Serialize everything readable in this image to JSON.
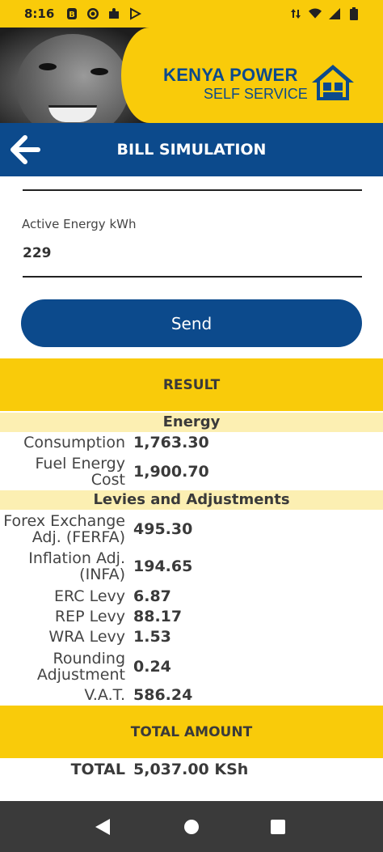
{
  "status_bar": {
    "time": "8:16"
  },
  "header": {
    "brand_title": "KENYA POWER",
    "brand_subtitle": "SELF SERVICE"
  },
  "titlebar": {
    "title": "BILL SIMULATION"
  },
  "form": {
    "field_label": "Active Energy kWh",
    "field_value": "229",
    "send_label": "Send"
  },
  "result": {
    "heading": "RESULT",
    "energy_section": "Energy",
    "energy_rows": [
      {
        "label": "Consumption",
        "value": "1,763.30"
      },
      {
        "label": "Fuel Energy Cost",
        "value": "1,900.70"
      }
    ],
    "levies_section": "Levies and Adjustments",
    "levy_rows": [
      {
        "label": "Forex Exchange Adj. (FERFA)",
        "value": "495.30"
      },
      {
        "label": "Inflation Adj. (INFA)",
        "value": "194.65"
      },
      {
        "label": "ERC Levy",
        "value": "6.87"
      },
      {
        "label": "REP Levy",
        "value": "88.17"
      },
      {
        "label": "WRA Levy",
        "value": "1.53"
      },
      {
        "label": "Rounding Adjustment",
        "value": "0.24"
      },
      {
        "label": "V.A.T.",
        "value": "586.24"
      }
    ],
    "total_heading": "TOTAL AMOUNT",
    "total_label": "TOTAL",
    "total_value": "5,037.00 KSh"
  },
  "colors": {
    "brand_yellow": "#f9cb0a",
    "brand_blue": "#0c4a8c",
    "section_tint": "#fcefb2"
  }
}
